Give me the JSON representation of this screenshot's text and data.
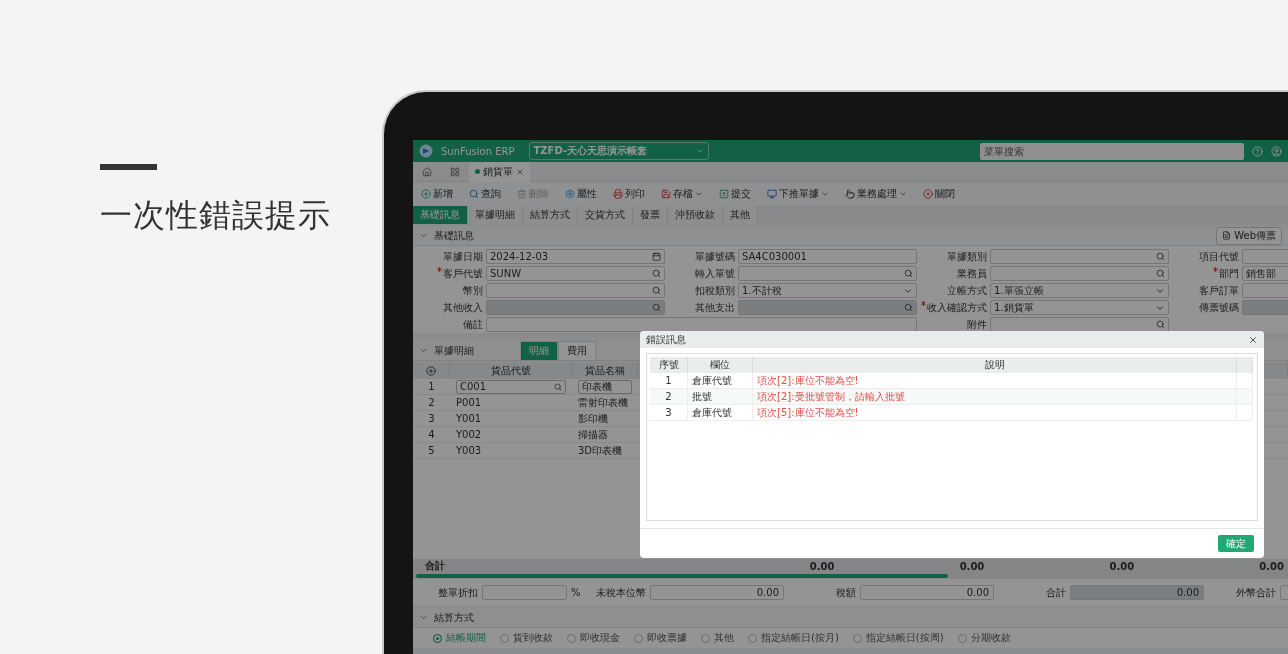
{
  "promo": {
    "title": "一次性錯誤提示"
  },
  "app": {
    "brand": "SunFusion ERP",
    "account": "TZFD-天心天思演示帳套",
    "menu_search": {
      "placeholder": "菜單搜索"
    },
    "open_tabs": [
      {
        "label": "銷貨單",
        "selected": true
      }
    ],
    "toolbar": [
      {
        "label": "新增",
        "disabled": false,
        "menu": false
      },
      {
        "label": "查詢",
        "disabled": false,
        "menu": false
      },
      {
        "label": "刪除",
        "disabled": true,
        "menu": false
      },
      {
        "label": "屬性",
        "disabled": false,
        "menu": false
      },
      {
        "label": "列印",
        "disabled": false,
        "menu": false
      },
      {
        "label": "存檔",
        "disabled": false,
        "menu": true
      },
      {
        "label": "提交",
        "disabled": false,
        "menu": false
      },
      {
        "label": "下推單據",
        "disabled": false,
        "menu": true
      },
      {
        "label": "業務處理",
        "disabled": false,
        "menu": true
      },
      {
        "label": "關閉",
        "disabled": false,
        "menu": false
      }
    ],
    "form_tabs": [
      {
        "label": "基礎訊息",
        "selected": true
      },
      {
        "label": "單據明細",
        "selected": false
      },
      {
        "label": "結算方式",
        "selected": false
      },
      {
        "label": "交貨方式",
        "selected": false
      },
      {
        "label": "發票",
        "selected": false
      },
      {
        "label": "沖預收款",
        "selected": false
      },
      {
        "label": "其他",
        "selected": false
      }
    ],
    "basic": {
      "title": "基礎訊息",
      "expanded": true,
      "actions": [
        "Web傳票"
      ],
      "fields": [
        {
          "label": "單據日期",
          "value": "2024-12-03",
          "kind": "date",
          "required": false,
          "disabled": false,
          "wide": false
        },
        {
          "label": "單據號碼",
          "value": "SA4C030001",
          "kind": "text",
          "required": false,
          "disabled": false,
          "wide": false
        },
        {
          "label": "單據類別",
          "kind": "search",
          "required": false,
          "disabled": false,
          "wide": false
        },
        {
          "label": "項目代號",
          "kind": "text",
          "required": false,
          "disabled": false,
          "wide": false
        },
        {
          "label": "客戶代號",
          "value": "SUNW",
          "kind": "search",
          "required": true,
          "disabled": false,
          "wide": false
        },
        {
          "label": "轉入單號",
          "kind": "search",
          "required": false,
          "disabled": false,
          "wide": false
        },
        {
          "label": "業務員",
          "kind": "search",
          "required": false,
          "disabled": false,
          "wide": false
        },
        {
          "label": "部門",
          "value": "銷售部",
          "kind": "text",
          "required": true,
          "disabled": false,
          "wide": false
        },
        {
          "label": "幣別",
          "kind": "search",
          "required": false,
          "disabled": false,
          "wide": false
        },
        {
          "label": "扣稅類別",
          "value": "1.不計稅",
          "kind": "select",
          "required": false,
          "disabled": false,
          "wide": false
        },
        {
          "label": "立帳方式",
          "value": "1.單張立帳",
          "kind": "select",
          "required": false,
          "disabled": false,
          "wide": false
        },
        {
          "label": "客戶訂單",
          "kind": "text",
          "required": false,
          "disabled": false,
          "wide": false
        },
        {
          "label": "其他收入",
          "kind": "search",
          "required": false,
          "disabled": true,
          "wide": false
        },
        {
          "label": "其他支出",
          "kind": "search",
          "required": false,
          "disabled": true,
          "wide": false
        },
        {
          "label": "收入確認方式",
          "value": "1.銷貨單",
          "kind": "select",
          "required": true,
          "disabled": false,
          "wide": false
        },
        {
          "label": "傳票號碼",
          "kind": "text",
          "required": false,
          "disabled": true,
          "wide": false
        },
        {
          "label": "備註",
          "kind": "text",
          "required": false,
          "disabled": false,
          "wide": true
        },
        {
          "label": "附件",
          "kind": "search",
          "required": false,
          "disabled": false,
          "wide": false
        }
      ]
    },
    "detail": {
      "title": "單據明細",
      "expanded": true,
      "tabs": [
        {
          "label": "明細",
          "selected": true
        },
        {
          "label": "費用",
          "selected": false
        }
      ],
      "columns": [
        "貨品代號",
        "貨品名稱"
      ],
      "rows": [
        {
          "no": "1",
          "code": "C001",
          "name": "印表機",
          "editing": true
        },
        {
          "no": "2",
          "code": "P001",
          "name": "雷射印表機",
          "editing": false
        },
        {
          "no": "3",
          "code": "Y001",
          "name": "影印機",
          "editing": false
        },
        {
          "no": "4",
          "code": "Y002",
          "name": "掃描器",
          "editing": false
        },
        {
          "no": "5",
          "code": "Y003",
          "name": "3D印表機",
          "editing": false
        }
      ],
      "totals": {
        "label": "合計",
        "values": [
          "0.00",
          "0.00",
          "0.00",
          "0.00"
        ]
      }
    },
    "summary": [
      {
        "label": "整單折扣",
        "unit": "%",
        "disabled": false
      },
      {
        "label": "未稅本位幣",
        "value": "0.00",
        "disabled": false
      },
      {
        "label": "稅額",
        "value": "0.00",
        "disabled": false
      },
      {
        "label": "合計",
        "value": "0.00",
        "disabled": true
      },
      {
        "label": "外幣合計",
        "disabled": false
      }
    ],
    "settlement": {
      "title": "結算方式",
      "expanded": true,
      "options": [
        {
          "label": "結帳期間",
          "selected": true
        },
        {
          "label": "貨到收款",
          "selected": false
        },
        {
          "label": "即收現金",
          "selected": false
        },
        {
          "label": "即收票據",
          "selected": false
        },
        {
          "label": "其他",
          "selected": false
        },
        {
          "label": "指定結帳日(按月)",
          "selected": false
        },
        {
          "label": "指定結帳日(按周)",
          "selected": false
        },
        {
          "label": "分期收款",
          "selected": false
        }
      ]
    },
    "dialog": {
      "title": "錯誤訊息",
      "columns": [
        "序號",
        "欄位",
        "說明"
      ],
      "rows": [
        {
          "no": "1",
          "field": "倉庫代號",
          "message": "項次[2]:庫位不能為空!"
        },
        {
          "no": "2",
          "field": "批號",
          "message": "項次[2]:受批號管制，請輸入批號"
        },
        {
          "no": "3",
          "field": "倉庫代號",
          "message": "項次[5]:庫位不能為空!"
        }
      ],
      "confirm": "確定"
    }
  }
}
